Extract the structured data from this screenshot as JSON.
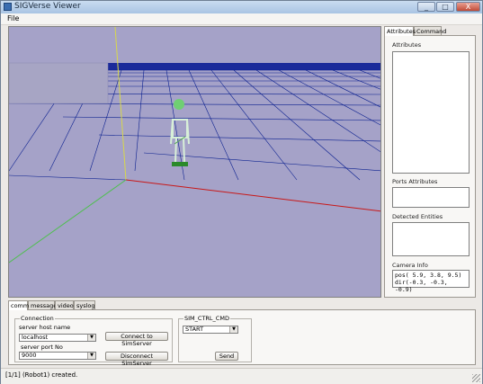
{
  "window": {
    "title": "SIGVerse Viewer",
    "controls": [
      "_",
      "□",
      "X"
    ]
  },
  "menu": {
    "items": [
      "File"
    ]
  },
  "side_panel": {
    "tabs": [
      "Attributes",
      "Command"
    ],
    "active_tab": "Attributes",
    "attributes_label": "Attributes",
    "ports_label": "Ports Attributes",
    "detected_label": "Detected Entities",
    "camera_label": "Camera Info",
    "camera_info": {
      "pos": "pos( 5.9,  3.8,  9.5)",
      "dir": "dir(-0.3, -0.3, -0.9)"
    }
  },
  "bottom_panel": {
    "tabs": [
      "comm",
      "messages",
      "video",
      "syslog"
    ],
    "active_tab": "comm",
    "connection": {
      "group_label": "Connection",
      "host_label": "server host name",
      "host_value": "localhost",
      "port_label": "server port No",
      "port_value": "9000",
      "connect_button": "Connect to SimServer",
      "disconnect_button": "Disconnect SimServer"
    },
    "sim_cmd": {
      "group_label": "SIM_CTRL_CMD",
      "command_value": "START",
      "send_button": "Send"
    }
  },
  "status_bar": {
    "message": "[1/1] (Robot1) created."
  },
  "colors": {
    "viewport_bg": "#a5a2c8",
    "floor_grid": "#0a1f8f",
    "axis_x": "#c81818",
    "axis_y": "#d8d84a",
    "axis_z": "#4fbf4f",
    "robot_green": "#6fcf73"
  }
}
